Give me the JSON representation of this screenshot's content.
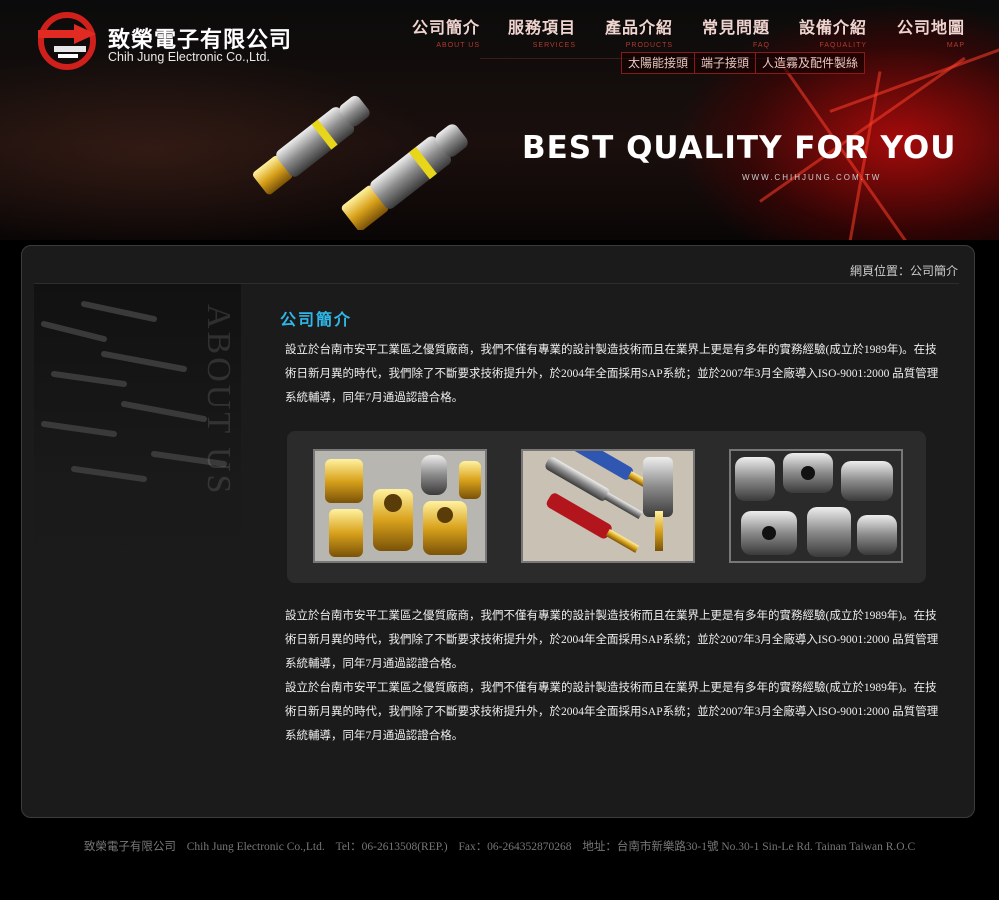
{
  "company": {
    "name_zh": "致榮電子有限公司",
    "name_en": "Chih Jung Electronic Co.,Ltd."
  },
  "nav": [
    {
      "zh": "公司簡介",
      "en": "ABOUT US"
    },
    {
      "zh": "服務項目",
      "en": "SERVICES"
    },
    {
      "zh": "產品介紹",
      "en": "PRODUCTS"
    },
    {
      "zh": "常見問題",
      "en": "FAQ"
    },
    {
      "zh": "設備介紹",
      "en": "FAQUALITY"
    },
    {
      "zh": "公司地圖",
      "en": "MAP"
    }
  ],
  "subnav": [
    "太陽能接頭",
    "端子接頭",
    "人造霧及配件製絲"
  ],
  "banner": {
    "slogan": "BEST QUALITY FOR YOU",
    "url": "WWW.CHIHJUNG.COM.TW"
  },
  "breadcrumb": "網頁位置：公司簡介",
  "side_label": "ABOUT US",
  "section_title": "公司簡介",
  "paragraphs": {
    "p1": "設立於台南市安平工業區之優質廠商，我們不僅有專業的設計製造技術而且在業界上更是有多年的實務經驗(成立於1989年)。在技術日新月異的時代，我們除了不斷要求技術提升外，於2004年全面採用SAP系統；並於2007年3月全廠導入ISO-9001:2000 品質管理系統輔導，同年7月通過認證合格。",
    "p2": "設立於台南市安平工業區之優質廠商，我們不僅有專業的設計製造技術而且在業界上更是有多年的實務經驗(成立於1989年)。在技術日新月異的時代，我們除了不斷要求技術提升外，於2004年全面採用SAP系統；並於2007年3月全廠導入ISO-9001:2000 品質管理系統輔導，同年7月通過認證合格。",
    "p3": "設立於台南市安平工業區之優質廠商，我們不僅有專業的設計製造技術而且在業界上更是有多年的實務經驗(成立於1989年)。在技術日新月異的時代，我們除了不斷要求技術提升外，於2004年全面採用SAP系統；並於2007年3月全廠導入ISO-9001:2000 品質管理系統輔導，同年7月通過認證合格。"
  },
  "footer": {
    "company": "致榮電子有限公司",
    "company_en": "Chih Jung Electronic Co.,Ltd.",
    "tel": "Tel：06-2613508(REP.)",
    "fax": "Fax：06-264352870268",
    "address": "地址：台南市新樂路30-1號  No.30-1 Sin-Le Rd. Tainan Taiwan R.O.C"
  },
  "colors": {
    "accent_red": "#d0201c",
    "title_blue": "#2fb7e8",
    "panel_bg": "#1b1b1b"
  }
}
